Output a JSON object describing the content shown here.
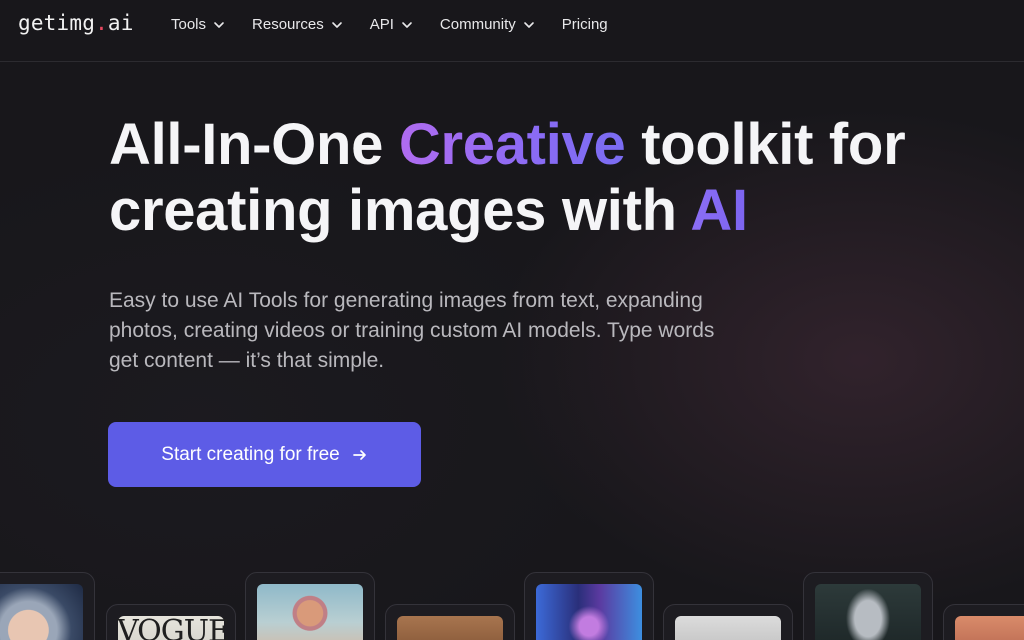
{
  "brand": {
    "logo_prefix": "getimg",
    "logo_dot": ".",
    "logo_suffix": "ai"
  },
  "nav": {
    "items": [
      {
        "label": "Tools",
        "has_dropdown": true
      },
      {
        "label": "Resources",
        "has_dropdown": true
      },
      {
        "label": "API",
        "has_dropdown": true
      },
      {
        "label": "Community",
        "has_dropdown": true
      },
      {
        "label": "Pricing",
        "has_dropdown": false
      }
    ]
  },
  "hero": {
    "headline_part1": "All-In-One ",
    "headline_highlight": "Creative",
    "headline_part2": " toolkit for creating images with ",
    "headline_highlight2": "AI",
    "subtitle": "Easy to use AI Tools for generating images from text, expanding photos, creating videos or training custom AI models. Type words get content — it’s that simple.",
    "cta_label": "Start creating for free"
  },
  "gallery": {
    "vogue_text": "VOGUE"
  },
  "colors": {
    "background": "#18171b",
    "cta": "#5d5ce6",
    "accent_gradient_start": "#b06cf0",
    "accent_gradient_end": "#7a6cf2",
    "logo_dot": "#e8475f"
  },
  "icons": {
    "dropdown": "chevron-down-icon",
    "cta": "arrow-right-icon"
  }
}
